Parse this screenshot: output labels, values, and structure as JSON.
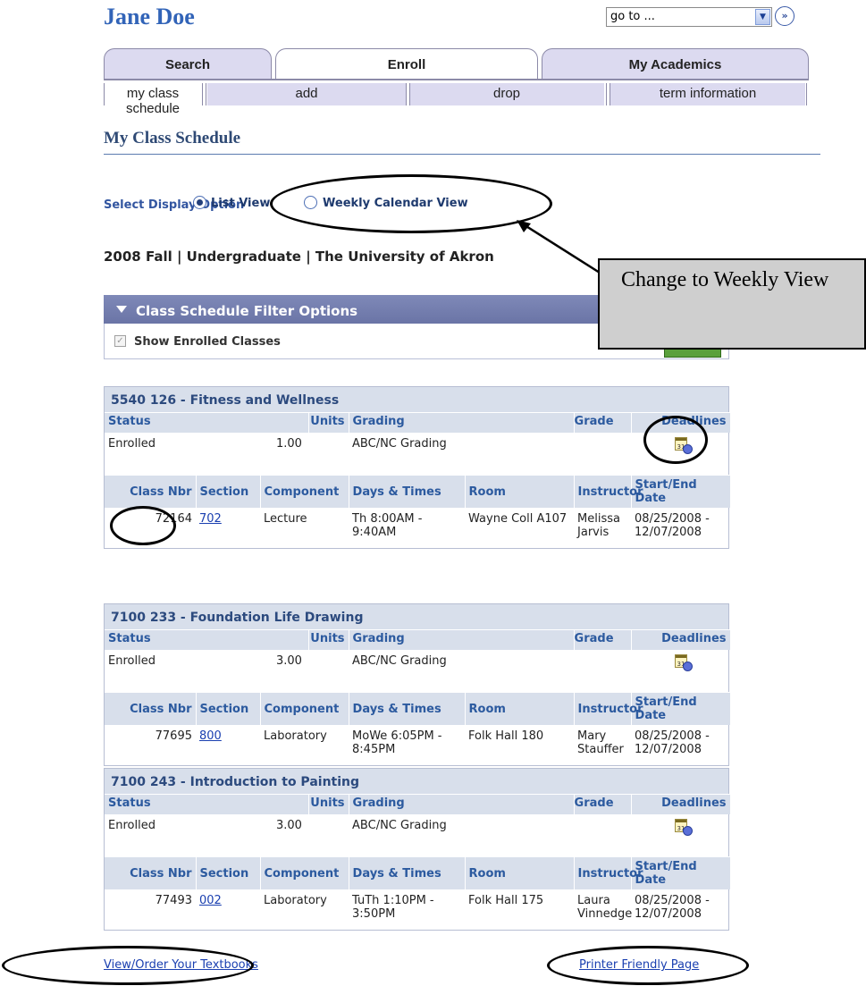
{
  "header": {
    "user_name": "Jane Doe",
    "goto_value": "go to ...",
    "goto_arrow_icon": "dropdown-arrow-icon",
    "go_icon": "double-chevron-right-icon",
    "go_symbol": "»"
  },
  "tabs": [
    {
      "label": "Search",
      "active": false
    },
    {
      "label": "Enroll",
      "active": true
    },
    {
      "label": "My Academics",
      "active": false
    }
  ],
  "subtabs": [
    {
      "label": "my class schedule",
      "active": true
    },
    {
      "label": "add",
      "active": false
    },
    {
      "label": "drop",
      "active": false
    },
    {
      "label": "term information",
      "active": false
    }
  ],
  "page_title": "My Class Schedule",
  "display_option": {
    "label": "Select Display Option",
    "options": [
      {
        "label": "List View",
        "selected": true
      },
      {
        "label": "Weekly Calendar View",
        "selected": false
      }
    ]
  },
  "term_line": "2008 Fall | Undergraduate | The University of Akron",
  "callout_text": "Change to Weekly View",
  "filter": {
    "title": "Class Schedule Filter Options",
    "checkbox_label": "Show Enrolled Classes",
    "checkbox_checked": true
  },
  "columns": {
    "status": "Status",
    "units": "Units",
    "grading": "Grading",
    "grade": "Grade",
    "deadlines": "Deadlines",
    "class_nbr": "Class Nbr",
    "section": "Section",
    "component": "Component",
    "days_times": "Days & Times",
    "room": "Room",
    "instructor": "Instructor",
    "start_end": "Start/End Date"
  },
  "courses": [
    {
      "title": "5540 126 - Fitness and Wellness",
      "status": "Enrolled",
      "units": "1.00",
      "grading": "ABC/NC Grading",
      "grade": "",
      "class_nbr": "72164",
      "section": "702",
      "component": "Lecture",
      "days_times": "Th 8:00AM - 9:40AM",
      "room": "Wayne Coll A107",
      "instructor": "Melissa Jarvis",
      "start_end": "08/25/2008 - 12/07/2008"
    },
    {
      "title": "7100 233 - Foundation Life Drawing",
      "status": "Enrolled",
      "units": "3.00",
      "grading": "ABC/NC Grading",
      "grade": "",
      "class_nbr": "77695",
      "section": "800",
      "component": "Laboratory",
      "days_times": "MoWe 6:05PM - 8:45PM",
      "room": "Folk Hall 180",
      "instructor": "Mary Stauffer",
      "start_end": "08/25/2008 - 12/07/2008"
    },
    {
      "title": "7100 243 - Introduction to Painting",
      "status": "Enrolled",
      "units": "3.00",
      "grading": "ABC/NC Grading",
      "grade": "",
      "class_nbr": "77493",
      "section": "002",
      "component": "Laboratory",
      "days_times": "TuTh 1:10PM - 3:50PM",
      "room": "Folk Hall 175",
      "instructor": "Laura Vinnedge",
      "start_end": "08/25/2008 - 12/07/2008"
    }
  ],
  "links": {
    "textbooks": "View/Order Your Textbooks",
    "printer": "Printer Friendly Page"
  },
  "colors": {
    "accent": "#3264b8",
    "tab_bg": "#dcdaf0",
    "table_header": "#d8dfeb",
    "filter_header": "#6a74a6"
  }
}
